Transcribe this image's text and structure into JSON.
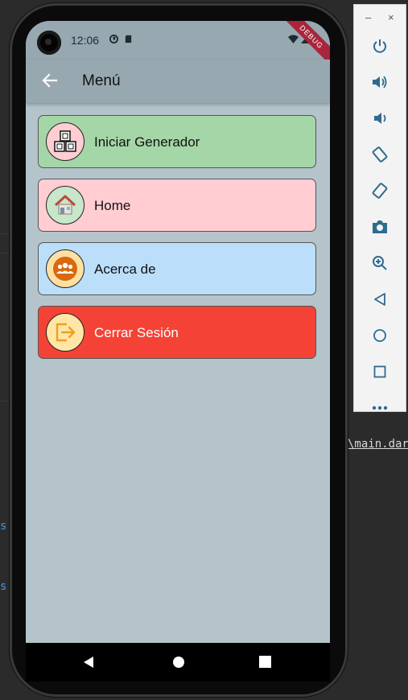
{
  "ide": {
    "file_ref": "\\main.dar",
    "side_marks": [
      "s",
      "s"
    ]
  },
  "status_bar": {
    "time": "12:06",
    "debug_banner": "DEBUG"
  },
  "app_bar": {
    "title": "Menú"
  },
  "menu": {
    "items": [
      {
        "label": "Iniciar Generador",
        "icon": "toy-blocks-icon",
        "bg": "#a5d6a7",
        "text_color": "#111111",
        "icon_bg": "#ffcdd2"
      },
      {
        "label": "Home",
        "icon": "house-icon",
        "bg": "#ffcdd2",
        "text_color": "#111111",
        "icon_bg": "#c8e6c9"
      },
      {
        "label": "Acerca de",
        "icon": "group-icon",
        "bg": "#bbdefb",
        "text_color": "#111111",
        "icon_bg": "#ffe0a3"
      },
      {
        "label": "Cerrar Sesión",
        "icon": "logout-icon",
        "bg": "#f44336",
        "text_color": "#ffffff",
        "icon_bg": "#ffe6a6"
      }
    ]
  },
  "emulator_panel": {
    "buttons": [
      "power-icon",
      "volume-up-icon",
      "volume-down-icon",
      "rotate-left-icon",
      "rotate-right-icon",
      "camera-icon",
      "zoom-icon",
      "back-icon",
      "home-icon",
      "overview-icon",
      "more-icon"
    ]
  }
}
